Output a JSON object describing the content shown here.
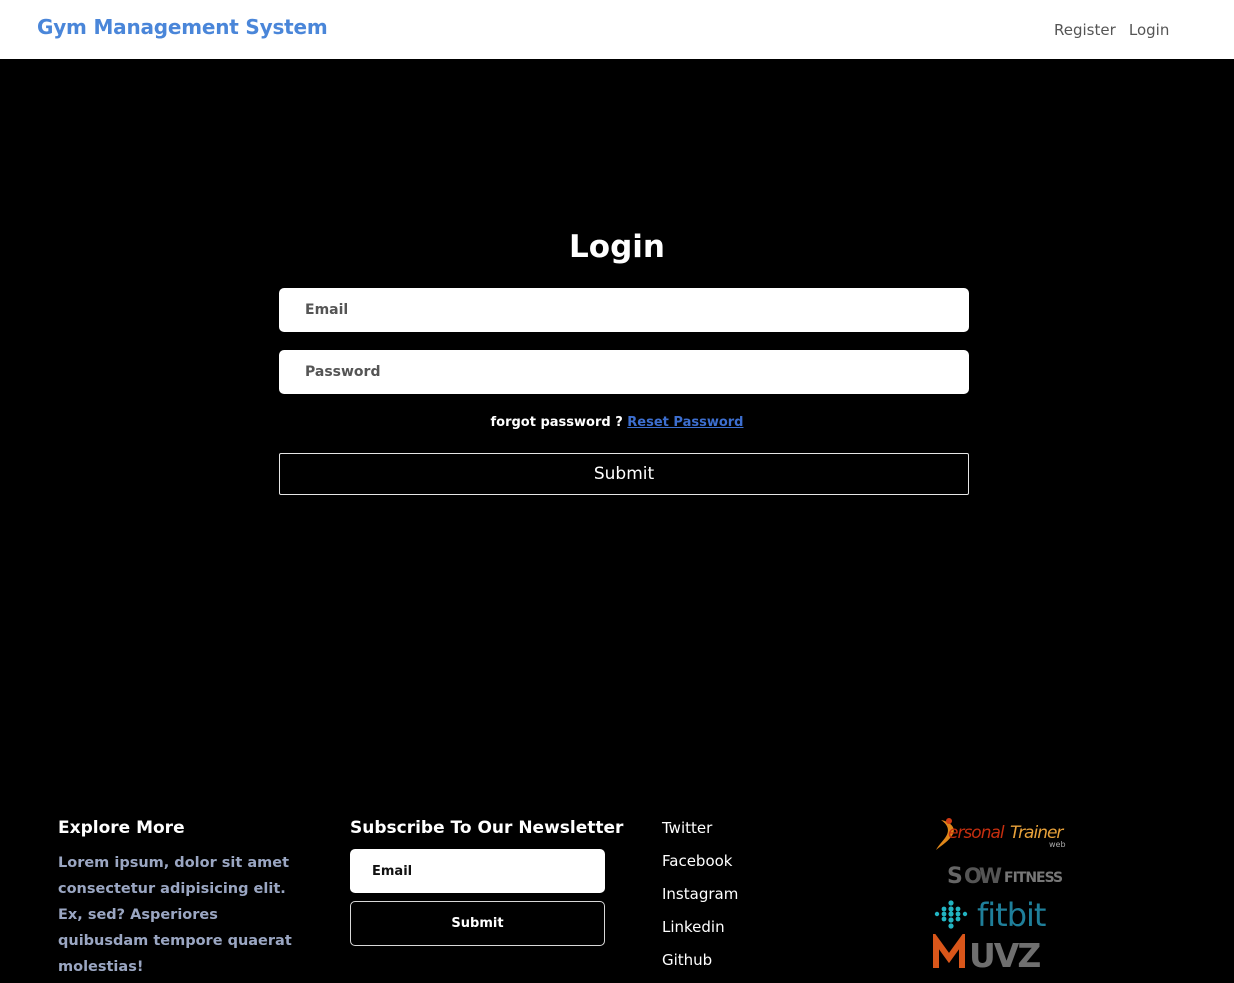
{
  "navbar": {
    "brand": "Gym Management System",
    "links": [
      {
        "label": "Register"
      },
      {
        "label": "Login"
      }
    ]
  },
  "login": {
    "title": "Login",
    "email_placeholder": "Email",
    "password_placeholder": "Password",
    "forgot_text": "forgot password ?",
    "reset_link": "Reset Password",
    "submit_label": "Submit"
  },
  "footer": {
    "explore": {
      "heading": "Explore More",
      "text": "Lorem ipsum, dolor sit amet consectetur adipisicing elit. Ex, sed? Asperiores quibusdam tempore quaerat molestias!"
    },
    "newsletter": {
      "heading": "Subscribe To Our Newsletter",
      "email_placeholder": "Email",
      "submit_label": "Submit"
    },
    "social": [
      {
        "label": "Twitter"
      },
      {
        "label": "Facebook"
      },
      {
        "label": "Instagram"
      },
      {
        "label": "Linkedin"
      },
      {
        "label": "Github"
      }
    ],
    "partner_logos": [
      {
        "name": "personal-trainer-logo",
        "text": "PersonalTrainer web"
      },
      {
        "name": "snow-fitness-logo",
        "text": "SnowFitness"
      },
      {
        "name": "fitbit-logo",
        "text": "fitbit"
      },
      {
        "name": "muvz-logo",
        "text": "MUVZ"
      }
    ]
  },
  "colors": {
    "brand": "#4a86d9",
    "background": "#000000",
    "link": "#3d6fd0"
  }
}
